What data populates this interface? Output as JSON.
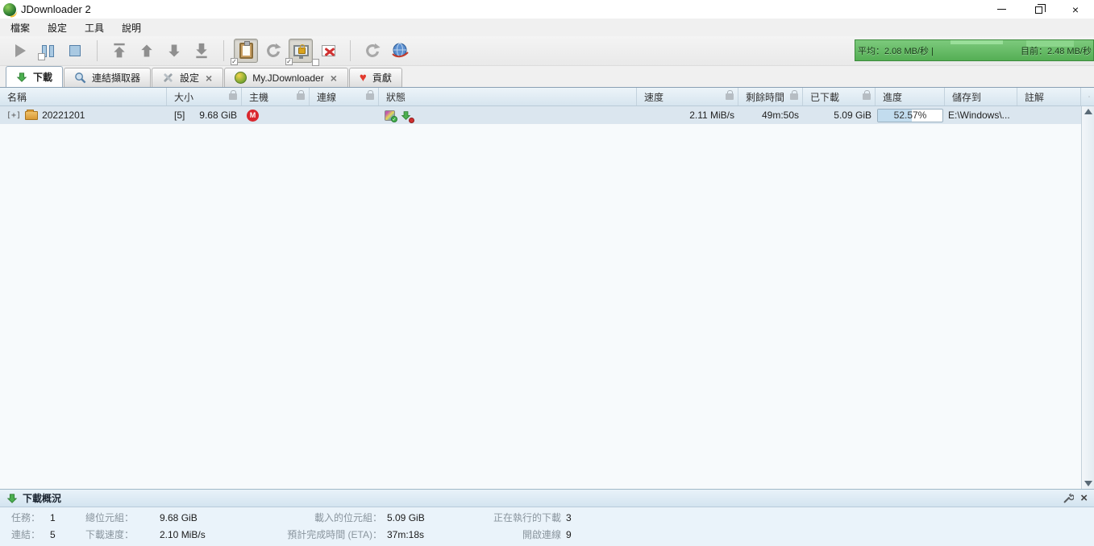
{
  "window": {
    "title": "JDownloader 2",
    "controls": {
      "close_glyph": "×"
    }
  },
  "menu": {
    "items": [
      "檔案",
      "設定",
      "工具",
      "說明"
    ]
  },
  "toolbar": {
    "buttons": [
      {
        "icon": "play-icon"
      },
      {
        "icon": "pause-icon"
      },
      {
        "icon": "stop-icon"
      },
      {
        "icon": "move-to-top-icon"
      },
      {
        "icon": "move-up-icon"
      },
      {
        "icon": "move-down-icon"
      },
      {
        "icon": "move-to-bottom-icon"
      },
      {
        "icon": "clipboard-observer-icon",
        "toggled": true
      },
      {
        "icon": "reconnect-icon"
      },
      {
        "icon": "premium-lock-icon",
        "toggled": true
      },
      {
        "icon": "remove-disabled-icon"
      },
      {
        "icon": "reconnect2-icon"
      },
      {
        "icon": "globe-update-icon"
      }
    ]
  },
  "speedmeter": {
    "average": "平均：2.08 MB/秒 |",
    "current": "目前：2.48 MB/秒"
  },
  "tabs": [
    {
      "label": "下載",
      "icon": "download-arrow-icon",
      "active": true
    },
    {
      "label": "連結擷取器",
      "icon": "magnifier-icon",
      "active": false
    },
    {
      "label": "設定",
      "icon": "tools-icon",
      "active": false,
      "close_glyph": "×"
    },
    {
      "label": "My.JDownloader",
      "icon": "myjd-icon",
      "active": false,
      "close_glyph": "×"
    },
    {
      "label": "貢獻",
      "icon": "heart-icon",
      "active": false
    }
  ],
  "table": {
    "columns": [
      {
        "label": "名稱",
        "locked": false
      },
      {
        "label": "大小",
        "locked": true
      },
      {
        "label": "主機",
        "locked": true
      },
      {
        "label": "連線",
        "locked": true
      },
      {
        "label": "狀態",
        "locked": false
      },
      {
        "label": "速度",
        "locked": true
      },
      {
        "label": "剩餘時間",
        "locked": true
      },
      {
        "label": "已下載",
        "locked": true
      },
      {
        "label": "進度",
        "locked": false
      },
      {
        "label": "儲存到",
        "locked": false
      },
      {
        "label": "註解",
        "locked": false
      }
    ],
    "row": {
      "expander": "[+]",
      "name": "20221201",
      "count": "[5]",
      "size": "9.68 GiB",
      "host_icon": "mega-icon",
      "host_letter": "M",
      "connection": "",
      "status_icons": [
        "archive-status-icon",
        "download-running-icon"
      ],
      "speed": "2.11 MiB/s",
      "eta": "49m:50s",
      "loaded": "5.09 GiB",
      "progress_label": "52.57%",
      "progress_percent": 52.57,
      "save_to": "E:\\Windows\\...",
      "comment": ""
    }
  },
  "overview": {
    "title": "下載概況",
    "stats": [
      {
        "label": "任務：",
        "value": "1"
      },
      {
        "label": "總位元組：",
        "value": "9.68 GiB"
      },
      {
        "label": "載入的位元組：",
        "value": "5.09 GiB"
      },
      {
        "label": "正在執行的下載",
        "value": "3"
      },
      {
        "label": "連結：",
        "value": "5"
      },
      {
        "label": "下載速度：",
        "value": "2.10 MiB/s"
      },
      {
        "label": "預計完成時間 (ETA)：",
        "value": "37m:18s"
      },
      {
        "label": "開啟連線",
        "value": "9"
      }
    ]
  },
  "colors": {
    "speed_green": "#54ae54",
    "mega_red": "#d9272e",
    "progress_fill": "#c2dcee",
    "heart_red": "#e23a2e",
    "download_green": "#3fae49"
  }
}
